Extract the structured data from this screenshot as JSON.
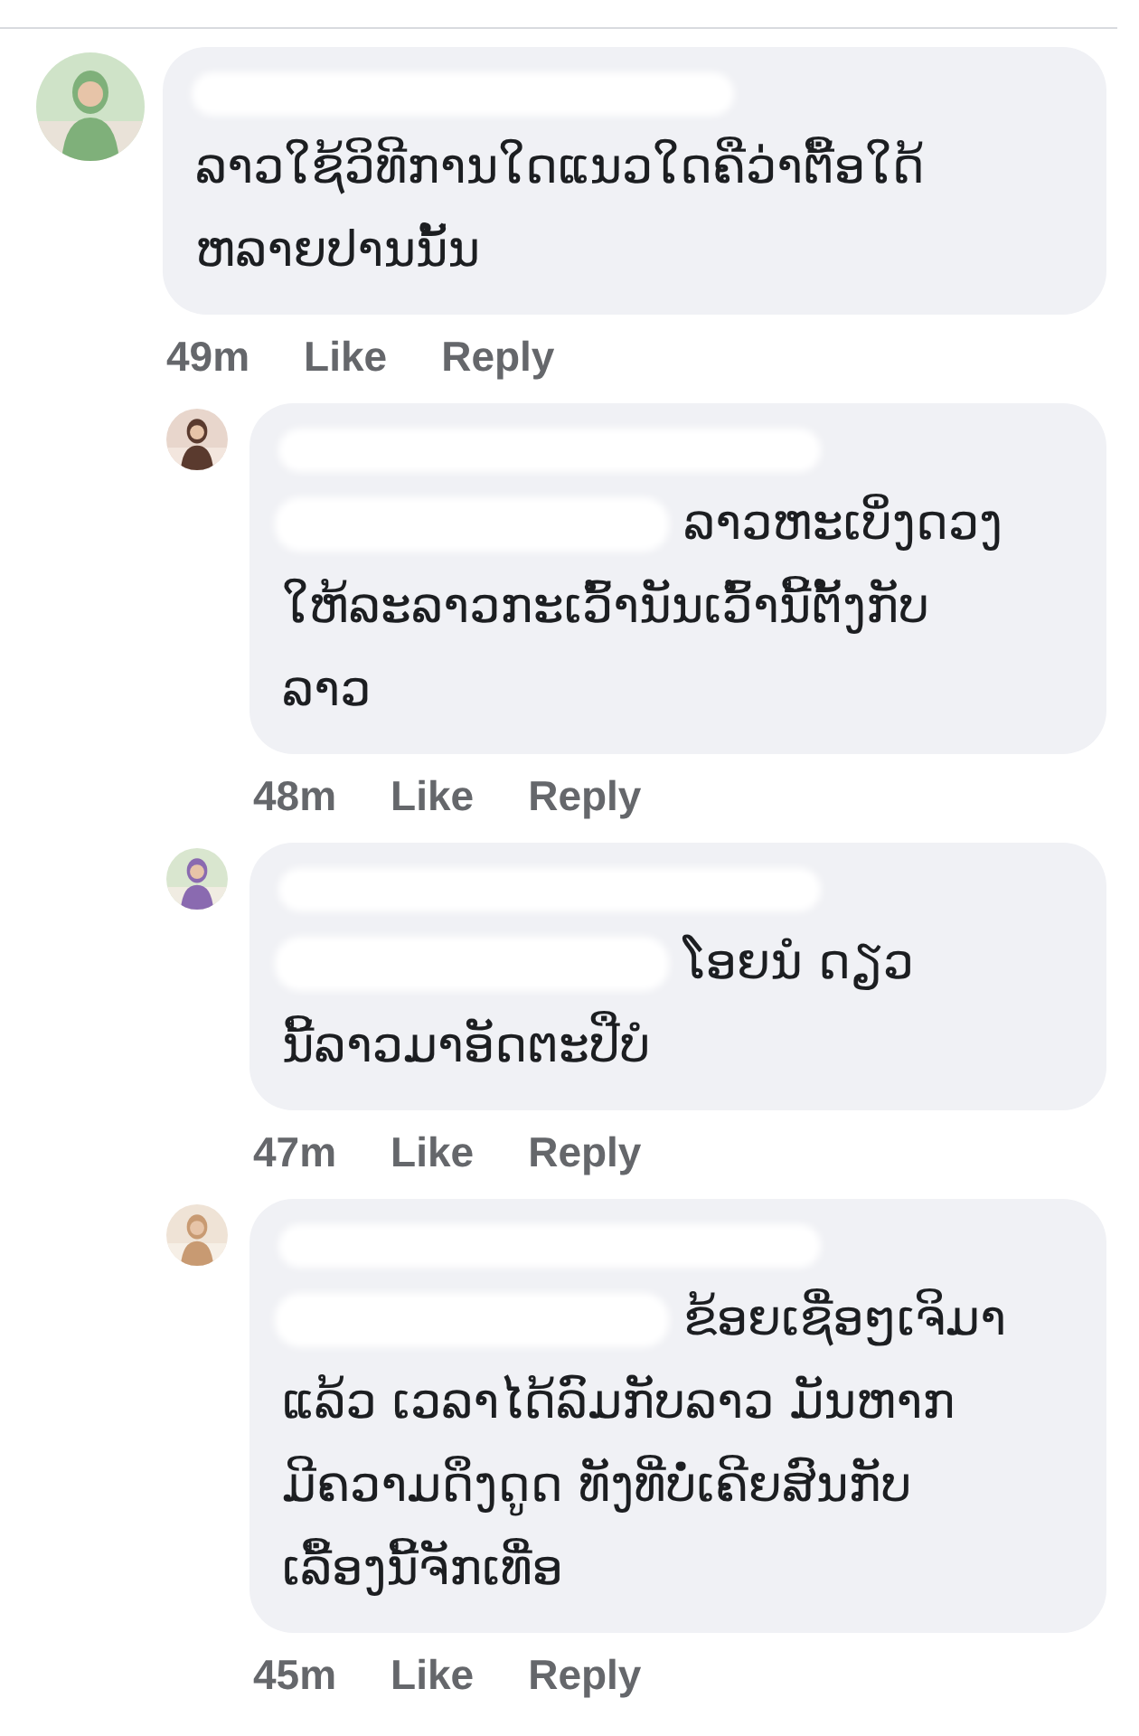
{
  "comments": [
    {
      "name_redacted": true,
      "lines": [
        "ລາວໃຊ້ວິທີການໃດແນວໃດຄືວ່າຕື້ອໃດ້",
        "ຫລາຍປານນັ້ນ"
      ],
      "time": "49m",
      "like": "Like",
      "reply": "Reply",
      "replies": [
        {
          "name_redacted": true,
          "mention_redacted": true,
          "lines": [
            "ລາວຫະເບິ່ງດວງ",
            "ໃຫ້ລະລາວກະເວົ້ານັນເວົ້ານີ້ຕັ້ງກັບ",
            "ລາວ"
          ],
          "time": "48m",
          "like": "Like",
          "reply": "Reply"
        },
        {
          "name_redacted": true,
          "mention_redacted": true,
          "lines": [
            "ໂອຍນໍ ດຽວ",
            "ນີ້ລາວມາອັດຕະປືບໍ"
          ],
          "time": "47m",
          "like": "Like",
          "reply": "Reply"
        },
        {
          "name_redacted": true,
          "mention_redacted": true,
          "lines": [
            "ຂ້ອຍເຊື່ອໆເຈິມາ",
            "ແລ້ວ ເວລາໄດ້ລົມກັບລາວ ມັນຫາກ",
            "ມີຄວາມດຶງດູດ ທັງທີ່ບໍ່ເຄີຍສົນກັບ",
            "ເລື້ອງນີ້ຈັກເທື່ອ"
          ],
          "time": "45m",
          "like": "Like",
          "reply": "Reply"
        }
      ]
    }
  ]
}
